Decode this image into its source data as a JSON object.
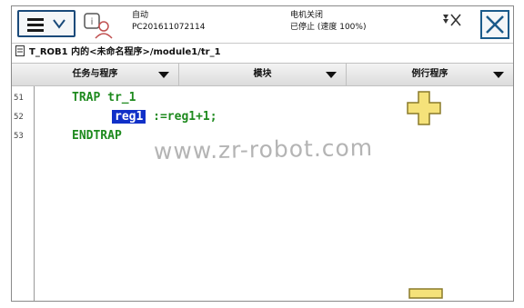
{
  "topbar": {
    "mode_label": "自动",
    "controller_name": "PC201611072114",
    "motor_state": "电机关闭",
    "run_state": "已停止 (速度 100%)"
  },
  "breadcrumb": {
    "text": "T_ROB1 内的<未命名程序>/module1/tr_1"
  },
  "tabs": [
    {
      "label": "任务与程序"
    },
    {
      "label": "模块"
    },
    {
      "label": "例行程序"
    }
  ],
  "editor": {
    "line_numbers": [
      "51",
      "52",
      "53"
    ],
    "lines": [
      {
        "text": "TRAP tr_1"
      },
      {
        "selected": "reg1",
        "rest": " :=reg1+1;"
      },
      {
        "text": "ENDTRAP"
      }
    ],
    "watermark": "www.zr-robot.com"
  },
  "colors": {
    "code_text": "#1e8a1e",
    "selection": "#1030c8",
    "zoom_buttons": "#f5e27a",
    "frame_accent": "#1a4a7a"
  },
  "icons": {
    "menu": "hamburger-icon",
    "expand": "chevron-down-icon",
    "robot": "robot-info-icon",
    "status": "status-icon",
    "close": "close-icon",
    "breadcrumb": "program-icon",
    "zoom_in": "plus-icon",
    "zoom_out": "minus-icon"
  }
}
